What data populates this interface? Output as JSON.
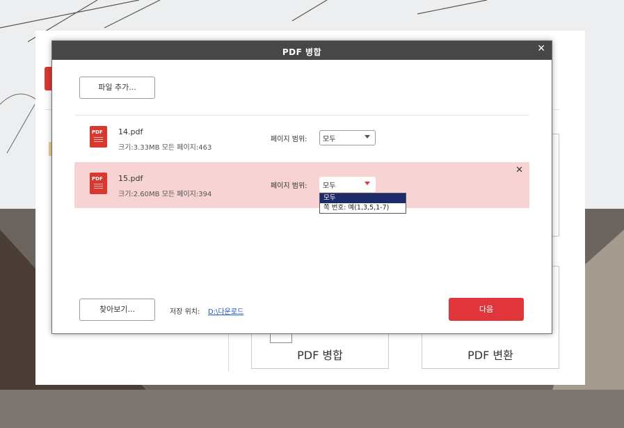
{
  "dialog": {
    "title": "PDF 병합",
    "add_file_label": "파일 추가...",
    "browse_label": "찾아보기...",
    "save_location_label": "저장 위치:",
    "save_location_path": "D:\\다운로드",
    "next_label": "다음"
  },
  "files": [
    {
      "name": "14.pdf",
      "info": "크기:3.33MB   모든 페이지:463",
      "range_label": "페이지 범위:",
      "range_value": "모두"
    },
    {
      "name": "15.pdf",
      "info": "크기:2.60MB   모든 페이지:394",
      "range_label": "페이지 범위:",
      "range_value": "모두"
    }
  ],
  "range_dropdown": {
    "options": [
      "모두",
      "쪽 번호: 예(1,3,5,1-7)"
    ],
    "selected": "모두"
  },
  "app": {
    "merge_card_label": "PDF 병합",
    "convert_card_label": "PDF 변환"
  },
  "colors": {
    "titlebar": "#474747",
    "accent_red": "#e0353a",
    "selected_row": "#f7d3d3",
    "dropdown_highlight": "#1d2b6a"
  }
}
